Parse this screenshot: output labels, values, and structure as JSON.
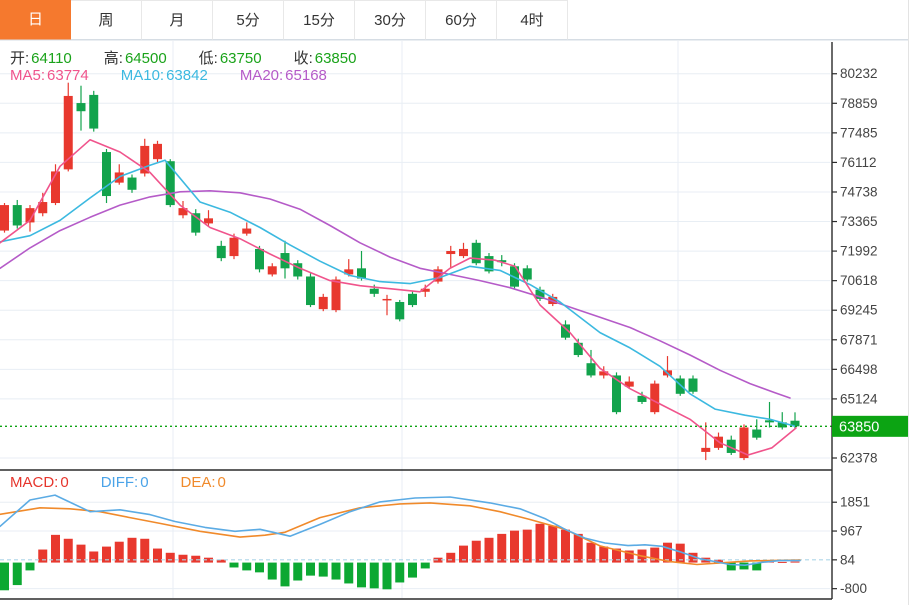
{
  "tabs": {
    "items": [
      {
        "label": "日",
        "active": true
      },
      {
        "label": "周",
        "active": false
      },
      {
        "label": "月",
        "active": false
      },
      {
        "label": "5分",
        "active": false
      },
      {
        "label": "15分",
        "active": false
      },
      {
        "label": "30分",
        "active": false
      },
      {
        "label": "60分",
        "active": false
      },
      {
        "label": "4时",
        "active": false
      }
    ],
    "active_bg": "#f5792e"
  },
  "ohlc_row": {
    "items": [
      {
        "label": "开:",
        "value": "64110"
      },
      {
        "label": "高:",
        "value": "64500"
      },
      {
        "label": "低:",
        "value": "63750"
      },
      {
        "label": "收:",
        "value": "63850"
      }
    ],
    "value_color": "#1aa31a"
  },
  "ma_row": {
    "items": [
      {
        "label": "MA5:",
        "value": "63774",
        "color": "#f0548c"
      },
      {
        "label": "MA10:",
        "value": "63842",
        "color": "#3cb9e0"
      },
      {
        "label": "MA20:",
        "value": "65168",
        "color": "#b55bc8"
      }
    ]
  },
  "macd_row": {
    "items": [
      {
        "label": "MACD:",
        "value": "0",
        "color": "#e6352c"
      },
      {
        "label": "DIFF:",
        "value": "0",
        "color": "#4aa3e8"
      },
      {
        "label": "DEA:",
        "value": "0",
        "color": "#f08a2b"
      }
    ]
  },
  "price_axis": {
    "ticks": [
      80232,
      78859,
      77485,
      76112,
      74738,
      73365,
      71992,
      70618,
      69245,
      67871,
      66498,
      65124,
      62378
    ],
    "current_tag": {
      "value": "63850",
      "bg": "#0ca413",
      "text_color": "#ffffff"
    }
  },
  "macd_axis": {
    "ticks": [
      1851,
      967,
      84,
      -800
    ]
  },
  "colors": {
    "candle_up": "#12a34c",
    "candle_down": "#e8382e",
    "hist_up_red": "#e8382e",
    "hist_down_green": "#0ca832",
    "ma5": "#f0548c",
    "ma10": "#3cb9e0",
    "ma20": "#b55bc8",
    "diff_line": "#5babe4",
    "dea_line": "#f08a2b",
    "grid": "#e8eef4",
    "axis_line": "#2b2b2b",
    "axis_text": "#444444",
    "dotted_price_line": "#0ca413",
    "dashed_zero_line": "#aed6e8",
    "panel_divider": "#000000"
  },
  "chart_data": {
    "type": "candlestick+macd",
    "x": {
      "n": 63,
      "x0": 4.5,
      "dx": 12.75,
      "vgrid_x": [
        173,
        402,
        678
      ]
    },
    "panels": {
      "price": {
        "ylim": [
          61960,
          81800
        ],
        "grid": true,
        "candles": [
          [
            74130,
            74225,
            72850,
            72945,
            "d"
          ],
          [
            73182,
            74367,
            73040,
            74130,
            "u"
          ],
          [
            73988,
            74130,
            72898,
            73324,
            "d"
          ],
          [
            74272,
            74699,
            73609,
            73751,
            "d"
          ],
          [
            75694,
            76026,
            74130,
            74225,
            "d"
          ],
          [
            79201,
            79817,
            75694,
            75789,
            "d"
          ],
          [
            78491,
            79676,
            77590,
            78870,
            "u"
          ],
          [
            77685,
            79438,
            77543,
            79249,
            "u"
          ],
          [
            74550,
            76736,
            74225,
            76594,
            "u"
          ],
          [
            75646,
            76026,
            75077,
            75172,
            "d"
          ],
          [
            74840,
            75551,
            74698,
            75409,
            "u"
          ],
          [
            76879,
            77211,
            75457,
            75599,
            "d"
          ],
          [
            76974,
            77116,
            76121,
            76263,
            "d"
          ],
          [
            74130,
            76263,
            74035,
            76168,
            "u"
          ],
          [
            73988,
            74319,
            73514,
            73656,
            "d"
          ],
          [
            72850,
            73940,
            72708,
            73751,
            "u"
          ],
          [
            73514,
            73893,
            73135,
            73277,
            "d"
          ],
          [
            71665,
            72471,
            71523,
            72234,
            "u"
          ],
          [
            72613,
            72803,
            71618,
            71760,
            "d"
          ],
          [
            73040,
            73324,
            72708,
            72803,
            "d"
          ],
          [
            71144,
            72234,
            71002,
            72092,
            "u"
          ],
          [
            71286,
            71428,
            70812,
            70907,
            "d"
          ],
          [
            71191,
            72471,
            70717,
            71902,
            "u"
          ],
          [
            70812,
            71570,
            70670,
            71428,
            "u"
          ],
          [
            69485,
            70954,
            69390,
            70812,
            "u"
          ],
          [
            69864,
            70006,
            69200,
            69295,
            "d"
          ],
          [
            70670,
            70812,
            69153,
            69248,
            "d"
          ],
          [
            71144,
            71618,
            70812,
            70907,
            "d"
          ],
          [
            70717,
            71997,
            70622,
            71191,
            "u"
          ],
          [
            70006,
            70433,
            69864,
            70243,
            "u"
          ],
          [
            69769,
            69959,
            69011,
            69722,
            "d"
          ],
          [
            68821,
            69722,
            68727,
            69627,
            "u"
          ],
          [
            69485,
            70148,
            69390,
            70006,
            "u"
          ],
          [
            70243,
            70433,
            69864,
            70101,
            "d"
          ],
          [
            71144,
            71286,
            70480,
            70575,
            "d"
          ],
          [
            71997,
            72234,
            71191,
            71855,
            "d"
          ],
          [
            72092,
            72376,
            71665,
            71760,
            "d"
          ],
          [
            71428,
            72518,
            71333,
            72376,
            "u"
          ],
          [
            71049,
            71902,
            70954,
            71760,
            "u"
          ],
          [
            71476,
            71807,
            71286,
            71570,
            "u"
          ],
          [
            70338,
            71428,
            70243,
            71286,
            "u"
          ],
          [
            70670,
            71333,
            70575,
            71191,
            "u"
          ],
          [
            69769,
            70338,
            69674,
            70196,
            "u"
          ],
          [
            69864,
            70006,
            69437,
            69532,
            "d"
          ],
          [
            67968,
            68774,
            67873,
            68584,
            "u"
          ],
          [
            67162,
            67921,
            67067,
            67731,
            "u"
          ],
          [
            66214,
            67399,
            66119,
            66783,
            "u"
          ],
          [
            66404,
            66641,
            66072,
            66214,
            "d"
          ],
          [
            64508,
            66356,
            64413,
            66214,
            "u"
          ],
          [
            65930,
            66167,
            65598,
            65693,
            "d"
          ],
          [
            64982,
            65456,
            64887,
            65266,
            "u"
          ],
          [
            65835,
            65977,
            64413,
            64508,
            "d"
          ],
          [
            66451,
            67114,
            66119,
            66214,
            "d"
          ],
          [
            65361,
            66214,
            65266,
            66072,
            "u"
          ],
          [
            65456,
            66214,
            65361,
            66072,
            "u"
          ],
          [
            62849,
            64034,
            62281,
            62660,
            "d"
          ],
          [
            63370,
            63560,
            62755,
            62849,
            "d"
          ],
          [
            62613,
            63418,
            62518,
            63228,
            "u"
          ],
          [
            63797,
            63939,
            62281,
            62376,
            "d"
          ],
          [
            63323,
            64176,
            63228,
            63702,
            "u"
          ],
          [
            64034,
            64982,
            63797,
            64129,
            "u"
          ],
          [
            63797,
            64508,
            63702,
            64034,
            "u"
          ],
          [
            64110,
            64500,
            63750,
            63850,
            "u"
          ]
        ],
        "last_close": 63850,
        "ma5": [
          [
            0,
            72376
          ],
          [
            30,
            73419
          ],
          [
            60,
            75931
          ],
          [
            90,
            77164
          ],
          [
            120,
            76595
          ],
          [
            150,
            75647
          ],
          [
            180,
            74130
          ],
          [
            210,
            73087
          ],
          [
            240,
            72566
          ],
          [
            270,
            71855
          ],
          [
            300,
            71191
          ],
          [
            330,
            70622
          ],
          [
            360,
            70385
          ],
          [
            390,
            70243
          ],
          [
            420,
            70101
          ],
          [
            450,
            71191
          ],
          [
            470,
            71665
          ],
          [
            495,
            71570
          ],
          [
            515,
            71286
          ],
          [
            540,
            69485
          ],
          [
            570,
            68205
          ],
          [
            600,
            66546
          ],
          [
            630,
            65598
          ],
          [
            660,
            64887
          ],
          [
            690,
            64176
          ],
          [
            720,
            63086
          ],
          [
            748,
            62518
          ],
          [
            772,
            62850
          ],
          [
            796,
            63774
          ]
        ],
        "ma10": [
          [
            0,
            72423
          ],
          [
            30,
            72708
          ],
          [
            60,
            73419
          ],
          [
            90,
            74461
          ],
          [
            120,
            75457
          ],
          [
            150,
            75978
          ],
          [
            165,
            76216
          ],
          [
            200,
            74272
          ],
          [
            230,
            73798
          ],
          [
            260,
            73087
          ],
          [
            290,
            72281
          ],
          [
            320,
            71523
          ],
          [
            350,
            70859
          ],
          [
            380,
            70575
          ],
          [
            410,
            70480
          ],
          [
            440,
            70764
          ],
          [
            470,
            71286
          ],
          [
            500,
            71097
          ],
          [
            530,
            70433
          ],
          [
            560,
            69627
          ],
          [
            600,
            68205
          ],
          [
            630,
            67494
          ],
          [
            660,
            66641
          ],
          [
            690,
            65361
          ],
          [
            715,
            64650
          ],
          [
            745,
            64366
          ],
          [
            770,
            64176
          ],
          [
            796,
            63842
          ]
        ],
        "ma20": [
          [
            0,
            71191
          ],
          [
            30,
            72139
          ],
          [
            60,
            72945
          ],
          [
            90,
            73561
          ],
          [
            120,
            74130
          ],
          [
            150,
            74509
          ],
          [
            180,
            74746
          ],
          [
            210,
            74793
          ],
          [
            240,
            74699
          ],
          [
            270,
            74414
          ],
          [
            300,
            73940
          ],
          [
            330,
            73182
          ],
          [
            360,
            72376
          ],
          [
            390,
            71713
          ],
          [
            420,
            71191
          ],
          [
            450,
            70907
          ],
          [
            480,
            70622
          ],
          [
            510,
            70290
          ],
          [
            540,
            69864
          ],
          [
            570,
            69390
          ],
          [
            600,
            68916
          ],
          [
            630,
            68442
          ],
          [
            660,
            67826
          ],
          [
            690,
            67162
          ],
          [
            720,
            66451
          ],
          [
            750,
            65835
          ],
          [
            775,
            65408
          ],
          [
            790,
            65168
          ]
        ]
      },
      "macd": {
        "ylim": [
          -1117,
          2839
        ],
        "hist": [
          -850,
          -690,
          -240,
          400,
          850,
          730,
          550,
          340,
          490,
          640,
          760,
          730,
          430,
          300,
          240,
          210,
          150,
          90,
          -150,
          -240,
          -300,
          -520,
          -730,
          -550,
          -400,
          -430,
          -520,
          -640,
          -760,
          -790,
          -820,
          -610,
          -460,
          -180,
          150,
          300,
          520,
          670,
          760,
          880,
          980,
          1010,
          1190,
          1130,
          1010,
          880,
          610,
          490,
          430,
          370,
          400,
          460,
          610,
          580,
          300,
          150,
          90,
          -240,
          -210,
          -240,
          30,
          20,
          30
        ],
        "diff": [
          [
            0,
            1110
          ],
          [
            30,
            1920
          ],
          [
            55,
            2070
          ],
          [
            90,
            1560
          ],
          [
            120,
            1620
          ],
          [
            150,
            1470
          ],
          [
            175,
            1260
          ],
          [
            205,
            1080
          ],
          [
            235,
            960
          ],
          [
            260,
            1020
          ],
          [
            290,
            810
          ],
          [
            320,
            1170
          ],
          [
            350,
            1560
          ],
          [
            380,
            1860
          ],
          [
            415,
            1980
          ],
          [
            450,
            2010
          ],
          [
            490,
            1830
          ],
          [
            520,
            1650
          ],
          [
            545,
            1350
          ],
          [
            565,
            1020
          ],
          [
            585,
            750
          ],
          [
            605,
            600
          ],
          [
            628,
            520
          ],
          [
            645,
            545
          ],
          [
            662,
            500
          ],
          [
            680,
            330
          ],
          [
            700,
            120
          ],
          [
            715,
            30
          ],
          [
            730,
            -60
          ],
          [
            745,
            -80
          ],
          [
            762,
            10
          ],
          [
            780,
            60
          ],
          [
            800,
            60
          ]
        ],
        "dea": [
          [
            0,
            1480
          ],
          [
            40,
            1680
          ],
          [
            70,
            1650
          ],
          [
            100,
            1560
          ],
          [
            130,
            1380
          ],
          [
            160,
            1200
          ],
          [
            200,
            960
          ],
          [
            240,
            780
          ],
          [
            265,
            840
          ],
          [
            285,
            930
          ],
          [
            320,
            1380
          ],
          [
            360,
            1680
          ],
          [
            400,
            1800
          ],
          [
            430,
            1830
          ],
          [
            470,
            1740
          ],
          [
            500,
            1560
          ],
          [
            530,
            1320
          ],
          [
            565,
            1020
          ],
          [
            600,
            510
          ],
          [
            640,
            210
          ],
          [
            670,
            30
          ],
          [
            697,
            -60
          ],
          [
            720,
            -10
          ],
          [
            750,
            50
          ],
          [
            800,
            75
          ]
        ]
      }
    }
  }
}
